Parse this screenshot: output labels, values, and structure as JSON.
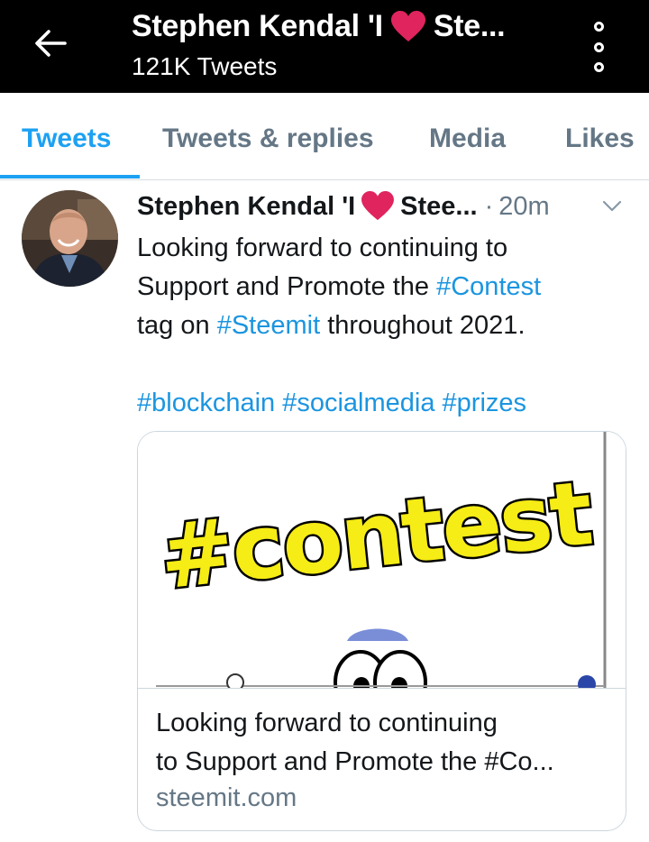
{
  "header": {
    "title_name": "Stephen Kendal 'I",
    "title_trail": "Ste...",
    "subtitle": "121K Tweets",
    "back_icon": "arrow-left-icon",
    "menu_icon": "overflow-vertical-icon"
  },
  "tabs": [
    {
      "label": "Tweets",
      "active": true
    },
    {
      "label": "Tweets & replies",
      "active": false
    },
    {
      "label": "Media",
      "active": false
    },
    {
      "label": "Likes",
      "active": false
    }
  ],
  "tweet": {
    "name_start": "Stephen Kendal 'I",
    "name_end": "Stee...",
    "separator": "·",
    "time": "20m",
    "text_line1": "Looking forward to continuing to",
    "text_line2a": "Support and Promote the ",
    "text_line2_tag": "#Contest",
    "text_line3a": "tag on ",
    "text_line3_tag": "#Steemit",
    "text_line3b": " throughout 2021.",
    "hashtags": "#blockchain #socialmedia #prizes",
    "card": {
      "image_text": "#contest",
      "title_line1": "Looking forward to continuing",
      "title_line2": "to Support and Promote the #Co...",
      "domain": "steemit.com"
    }
  },
  "colors": {
    "accent": "#1da1f2",
    "link": "#1b95e0",
    "heart": "#e0245e",
    "header_bg": "#000000",
    "muted": "#657786"
  }
}
